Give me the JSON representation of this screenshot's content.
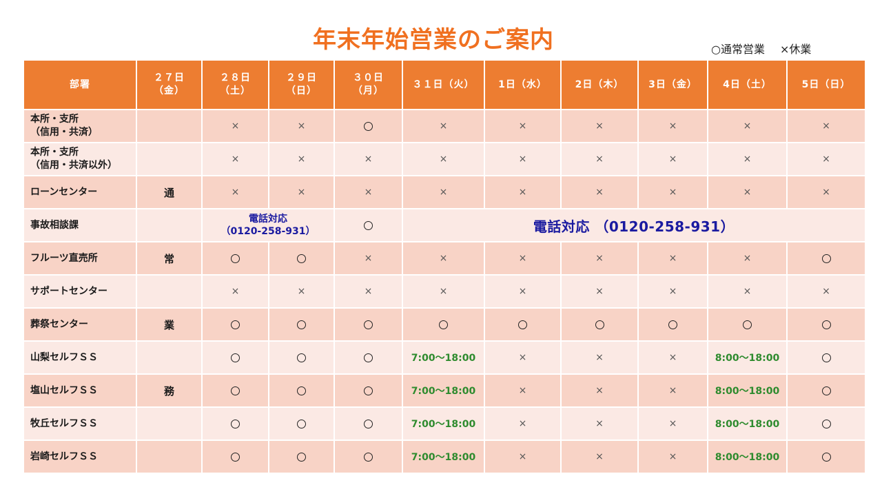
{
  "title": "年末年始営業のご案内",
  "legend": {
    "open": "○通常営業",
    "closed": "×休業"
  },
  "symbols": {
    "closed": "×",
    "open_icon": "circle-icon"
  },
  "headers": {
    "dept": "部署",
    "d27": "２７日",
    "d27_day": "（金）",
    "d28": "２８日",
    "d28_day": "（土）",
    "d29": "２９日",
    "d29_day": "（日）",
    "d30": "３０日",
    "d30_day": "（月）",
    "d31": "３１日（火）",
    "d1": "1日（水）",
    "d2": "2日（木）",
    "d3": "3日（金）",
    "d4": "4日（土）",
    "d5": "5日（日）"
  },
  "note_chars": {
    "c1": "通",
    "c2": "常",
    "c3": "業",
    "c4": "務"
  },
  "rows": [
    {
      "dept1": "本所・支所",
      "dept2": "（信用・共済）"
    },
    {
      "dept1": "本所・支所",
      "dept2": "（信用・共済以外）"
    },
    {
      "dept1": "ローンセンター"
    },
    {
      "dept1": "事故相談課",
      "tel_small1": "電話対応",
      "tel_small2": "（0120-258-931）",
      "tel_big": "電話対応 （0120-258-931）"
    },
    {
      "dept1": "フルーツ直売所"
    },
    {
      "dept1": "サポートセンター"
    },
    {
      "dept1": "葬祭センター"
    },
    {
      "dept1": "山梨セルフＳＳ",
      "time31": "7:00～18:00",
      "time4": "8:00～18:00"
    },
    {
      "dept1": "塩山セルフＳＳ",
      "time31": "7:00～18:00",
      "time4": "8:00～18:00"
    },
    {
      "dept1": "牧丘セルフＳＳ",
      "time31": "7:00～18:00",
      "time4": "8:00～18:00"
    },
    {
      "dept1": "岩崎セルフＳＳ",
      "time31": "7:00～18:00",
      "time4": "8:00～18:00"
    }
  ],
  "colors": {
    "header": "#ed7d31",
    "title": "#f07020",
    "row_odd": "#f8d3c6",
    "row_even": "#fbe9e4",
    "phone": "#1a1aa0",
    "time": "#2e8b2e"
  }
}
